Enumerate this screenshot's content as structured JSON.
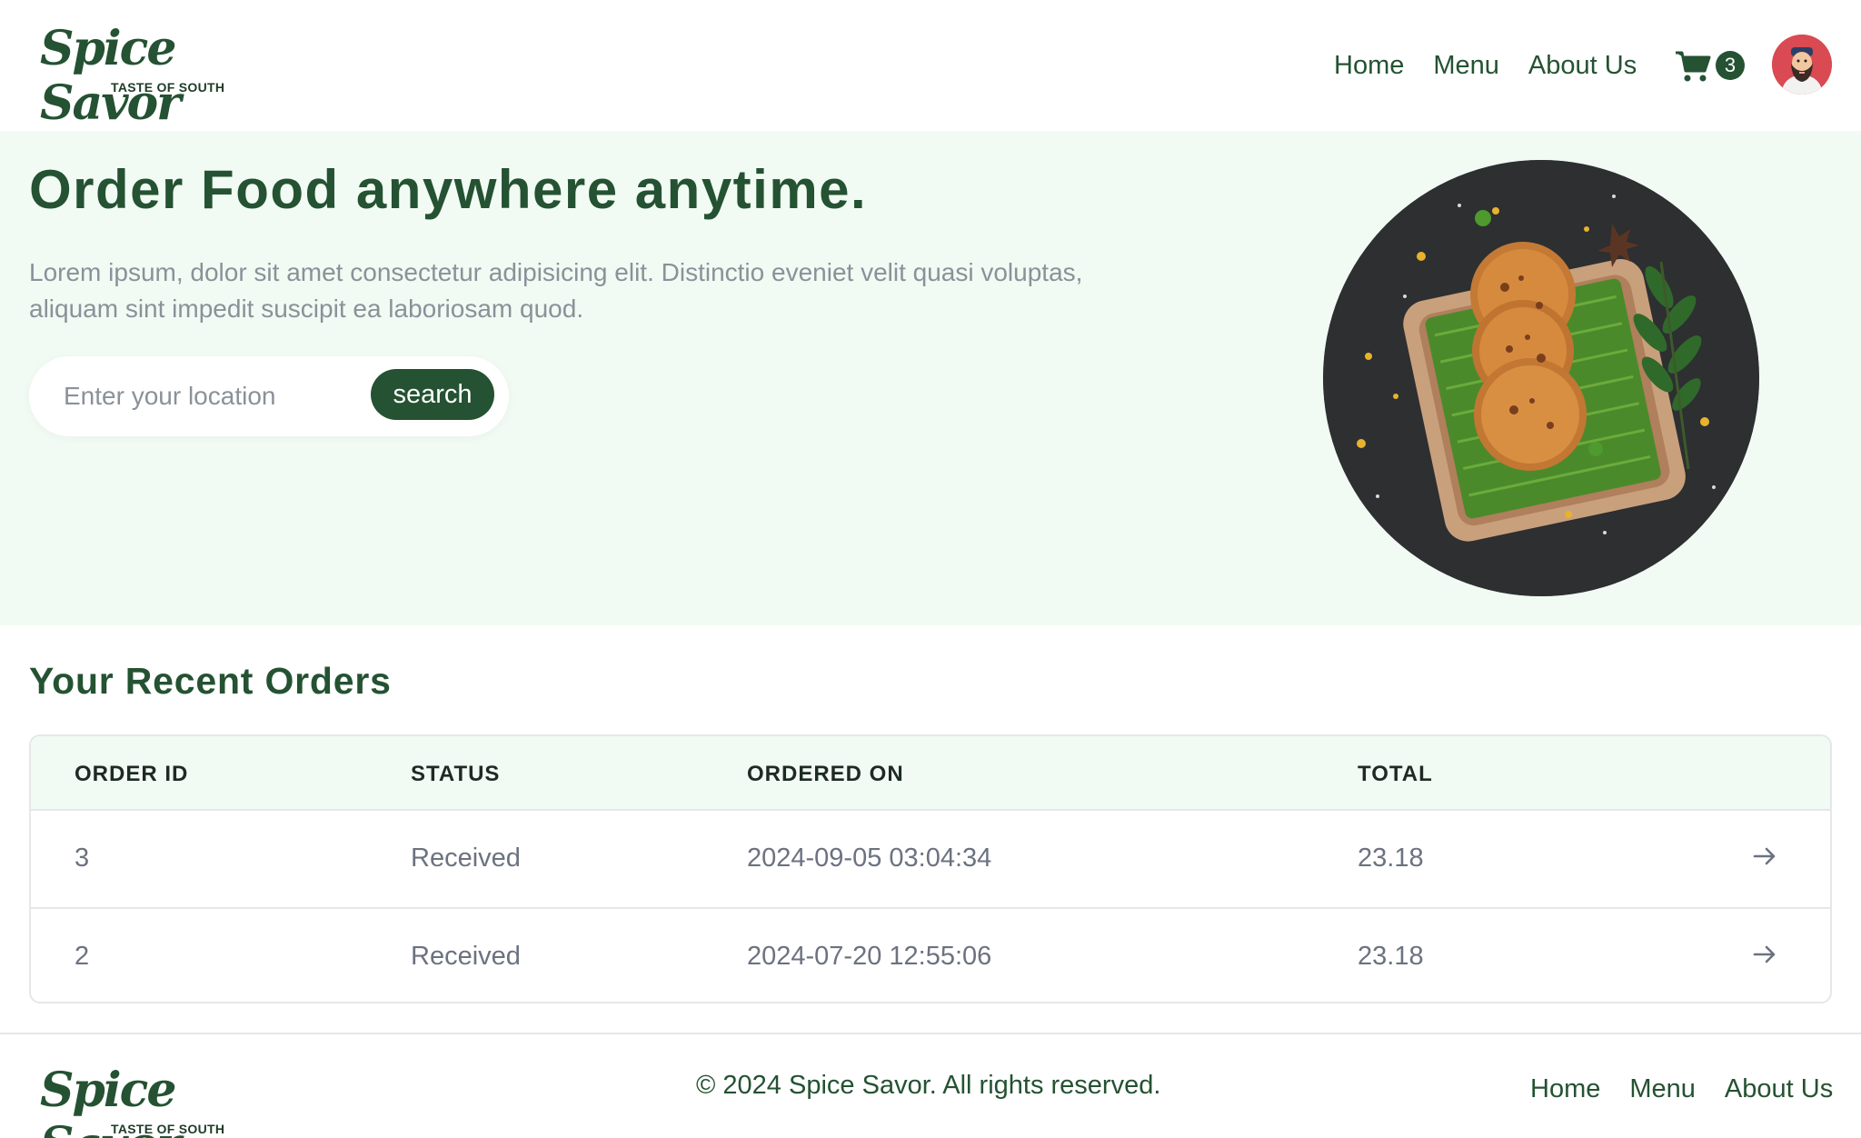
{
  "brand": {
    "name": "Spice Savor",
    "tagline": "TASTE OF SOUTH"
  },
  "header": {
    "nav": [
      "Home",
      "Menu",
      "About Us"
    ],
    "cart_count": "3"
  },
  "hero": {
    "title": "Order Food anywhere anytime.",
    "description": "Lorem ipsum, dolor sit amet consectetur adipisicing elit. Distinctio eveniet velit quasi voluptas, aliquam sint impedit suscipit ea laboriosam quod.",
    "search_placeholder": "Enter your location",
    "search_label": "search"
  },
  "orders": {
    "title": "Your Recent Orders",
    "columns": [
      "ORDER ID",
      "STATUS",
      "ORDERED ON",
      "TOTAL"
    ],
    "rows": [
      {
        "id": "3",
        "status": "Received",
        "ordered_on": "2024-09-05 03:04:34",
        "total": "23.18"
      },
      {
        "id": "2",
        "status": "Received",
        "ordered_on": "2024-07-20 12:55:06",
        "total": "23.18"
      }
    ]
  },
  "footer": {
    "copyright": "© 2024 Spice Savor. All rights reserved.",
    "nav": [
      "Home",
      "Menu",
      "About Us"
    ]
  },
  "colors": {
    "primary": "#245232",
    "hero_bg": "#f1fbf3",
    "muted_text": "#8a9199"
  },
  "icons": [
    "cart-icon",
    "avatar",
    "arrow-right-icon"
  ]
}
